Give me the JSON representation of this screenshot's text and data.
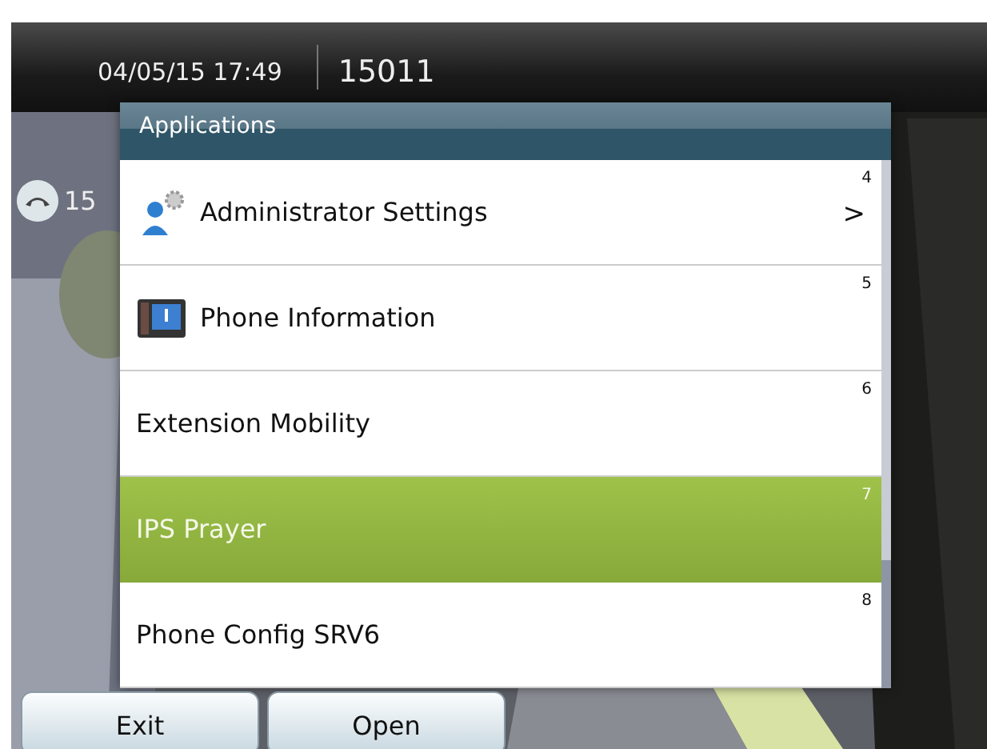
{
  "header": {
    "datetime": "04/05/15 17:49",
    "extension": "15011"
  },
  "line": {
    "label": "15"
  },
  "menu": {
    "title": "Applications",
    "items": [
      {
        "number": "4",
        "label": "Administrator Settings",
        "kind": "admin",
        "submenu": ">",
        "selected": false
      },
      {
        "number": "5",
        "label": "Phone Information",
        "kind": "phone",
        "selected": false
      },
      {
        "number": "6",
        "label": "Extension Mobility",
        "selected": false
      },
      {
        "number": "7",
        "label": "IPS Prayer",
        "selected": true
      },
      {
        "number": "8",
        "label": "Phone Config SRV6",
        "selected": false
      }
    ]
  },
  "softkeys": [
    "Exit",
    "Open"
  ]
}
